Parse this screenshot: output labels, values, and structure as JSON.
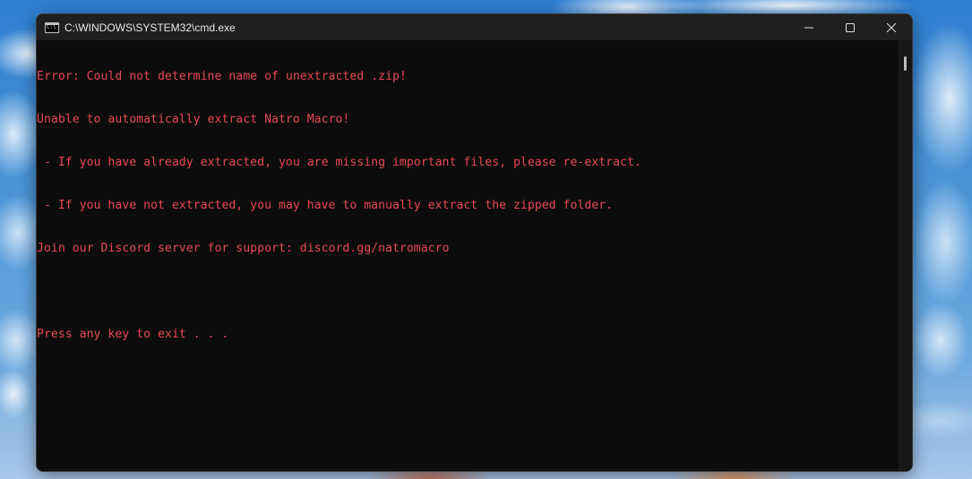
{
  "window": {
    "title": "C:\\WINDOWS\\SYSTEM32\\cmd.exe",
    "icon": "console-icon"
  },
  "controls": {
    "minimize_icon": "minimize-icon",
    "maximize_icon": "maximize-icon",
    "close_icon": "close-icon"
  },
  "console": {
    "text_color": "#e74856",
    "background": "#0c0c0c",
    "lines": [
      "Error: Could not determine name of unextracted .zip!",
      "Unable to automatically extract Natro Macro!",
      " - If you have already extracted, you are missing important files, please re-extract.",
      " - If you have not extracted, you may have to manually extract the zipped folder.",
      "Join our Discord server for support: discord.gg/natromacro",
      "",
      "Press any key to exit . . ."
    ]
  }
}
